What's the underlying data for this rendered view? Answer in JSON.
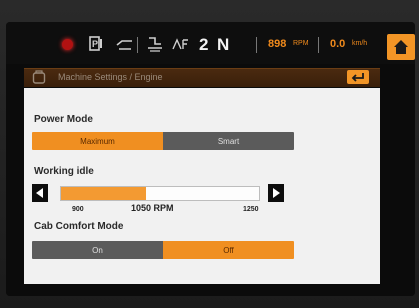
{
  "status_bar": {
    "gear_number": "2",
    "gear_mode": "N",
    "engine_rpm": "898",
    "engine_rpm_unit": "RPM",
    "speed": "0.0",
    "speed_unit": "km/h"
  },
  "title_bar": {
    "title": "Machine Settings / Engine"
  },
  "power_mode": {
    "label": "Power Mode",
    "options": [
      "Maximum",
      "Smart"
    ],
    "selected": "Maximum"
  },
  "working_idle": {
    "label": "Working idle",
    "min_label": "900",
    "max_label": "1250",
    "current_label": "1050 RPM",
    "min": 900,
    "max": 1250,
    "value": 1050
  },
  "cab_comfort_mode": {
    "label": "Cab Comfort Mode",
    "options": [
      "On",
      "Off"
    ],
    "selected": "Off"
  },
  "colors": {
    "accent": "#f08f21",
    "inactive": "#5b5b5b",
    "alarm": "#b11212"
  }
}
